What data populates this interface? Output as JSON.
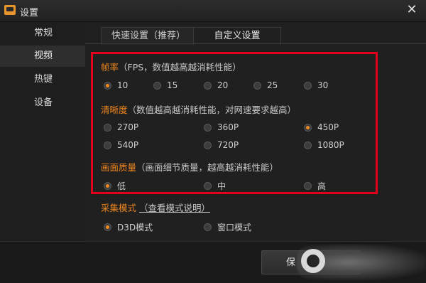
{
  "window": {
    "title": "设置",
    "close_glyph": "✕"
  },
  "sidebar": {
    "items": [
      {
        "label": "常规"
      },
      {
        "label": "视频"
      },
      {
        "label": "热键"
      },
      {
        "label": "设备"
      }
    ]
  },
  "tabs": [
    {
      "label": "快速设置（推荐）"
    },
    {
      "label": "自定义设置"
    }
  ],
  "framerate": {
    "label": "帧率",
    "note": "（FPS，数值越高越消耗性能）",
    "options": [
      "10",
      "15",
      "20",
      "25",
      "30"
    ],
    "selected": "10"
  },
  "resolution": {
    "label": "清晰度",
    "note": "（数值越高越消耗性能，对网速要求越高）",
    "options": [
      "270P",
      "360P",
      "450P",
      "540P",
      "720P",
      "1080P"
    ],
    "selected": "450P"
  },
  "quality": {
    "label": "画面质量",
    "note": "（画面细节质量，越高越消耗性能）",
    "options": [
      "低",
      "中",
      "高"
    ],
    "selected": "低"
  },
  "capture": {
    "label": "采集模式",
    "link": "（查看模式说明）",
    "options": [
      "D3D模式",
      "窗口模式"
    ],
    "selected": "D3D模式"
  },
  "footer": {
    "save_label": "保"
  },
  "colors": {
    "accent": "#f0871e",
    "highlight_box": "#e3001b",
    "background": "#1b1b1b"
  }
}
